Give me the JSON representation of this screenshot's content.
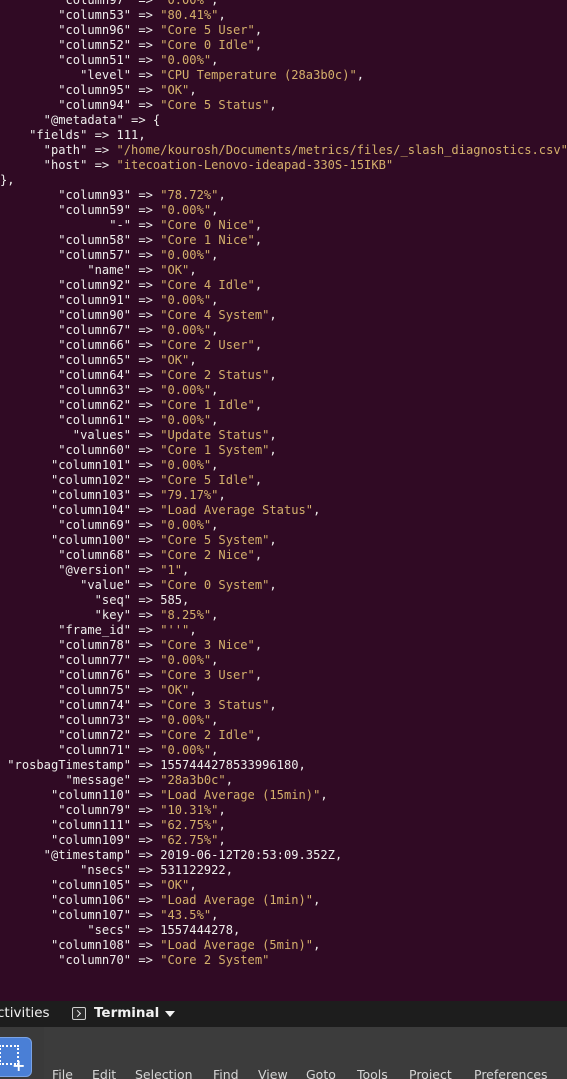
{
  "terminal_lines": [
    {
      "key": "        \"column97\"",
      "value": "\"0.00%\"",
      "sep": ","
    },
    {
      "key": "        \"column53\"",
      "value": "\"80.41%\"",
      "sep": ","
    },
    {
      "key": "        \"column96\"",
      "value": "\"Core 5 User\"",
      "sep": ","
    },
    {
      "key": "        \"column52\"",
      "value": "\"Core 0 Idle\"",
      "sep": ","
    },
    {
      "key": "        \"column51\"",
      "value": "\"0.00%\"",
      "sep": ","
    },
    {
      "key": "           \"level\"",
      "value": "\"CPU Temperature (28a3b0c)\"",
      "sep": ","
    },
    {
      "key": "        \"column95\"",
      "value": "\"OK\"",
      "sep": ","
    },
    {
      "key": "        \"column94\"",
      "value": "\"Core 5 Status\"",
      "sep": ","
    },
    {
      "key": "      \"@metadata\"",
      "value": "{",
      "sep": ""
    },
    {
      "key": "    \"fields\"",
      "value": "111",
      "sep": ","
    },
    {
      "key": "      \"path\"",
      "value": "\"/home/kourosh/Documents/metrics/files/_slash_diagnostics.csv\"",
      "sep": ","
    },
    {
      "key": "      \"host\"",
      "value": "\"itecoation-Lenovo-ideapad-330S-15IKB\"",
      "sep": ""
    },
    {
      "raw": "},"
    },
    {
      "key": "        \"column93\"",
      "value": "\"78.72%\"",
      "sep": ","
    },
    {
      "key": "        \"column59\"",
      "value": "\"0.00%\"",
      "sep": ","
    },
    {
      "key": "               \"-\"",
      "value": "\"Core 0 Nice\"",
      "sep": ","
    },
    {
      "key": "        \"column58\"",
      "value": "\"Core 1 Nice\"",
      "sep": ","
    },
    {
      "key": "        \"column57\"",
      "value": "\"0.00%\"",
      "sep": ","
    },
    {
      "key": "            \"name\"",
      "value": "\"OK\"",
      "sep": ","
    },
    {
      "key": "        \"column92\"",
      "value": "\"Core 4 Idle\"",
      "sep": ","
    },
    {
      "key": "        \"column91\"",
      "value": "\"0.00%\"",
      "sep": ","
    },
    {
      "key": "        \"column90\"",
      "value": "\"Core 4 System\"",
      "sep": ","
    },
    {
      "key": "        \"column67\"",
      "value": "\"0.00%\"",
      "sep": ","
    },
    {
      "key": "        \"column66\"",
      "value": "\"Core 2 User\"",
      "sep": ","
    },
    {
      "key": "        \"column65\"",
      "value": "\"OK\"",
      "sep": ","
    },
    {
      "key": "        \"column64\"",
      "value": "\"Core 2 Status\"",
      "sep": ","
    },
    {
      "key": "        \"column63\"",
      "value": "\"0.00%\"",
      "sep": ","
    },
    {
      "key": "        \"column62\"",
      "value": "\"Core 1 Idle\"",
      "sep": ","
    },
    {
      "key": "        \"column61\"",
      "value": "\"0.00%\"",
      "sep": ","
    },
    {
      "key": "          \"values\"",
      "value": "\"Update Status\"",
      "sep": ","
    },
    {
      "key": "        \"column60\"",
      "value": "\"Core 1 System\"",
      "sep": ","
    },
    {
      "key": "       \"column101\"",
      "value": "\"0.00%\"",
      "sep": ","
    },
    {
      "key": "       \"column102\"",
      "value": "\"Core 5 Idle\"",
      "sep": ","
    },
    {
      "key": "       \"column103\"",
      "value": "\"79.17%\"",
      "sep": ","
    },
    {
      "key": "       \"column104\"",
      "value": "\"Load Average Status\"",
      "sep": ","
    },
    {
      "key": "        \"column69\"",
      "value": "\"0.00%\"",
      "sep": ","
    },
    {
      "key": "       \"column100\"",
      "value": "\"Core 5 System\"",
      "sep": ","
    },
    {
      "key": "        \"column68\"",
      "value": "\"Core 2 Nice\"",
      "sep": ","
    },
    {
      "key": "        \"@version\"",
      "value": "\"1\"",
      "sep": ","
    },
    {
      "key": "           \"value\"",
      "value": "\"Core 0 System\"",
      "sep": ","
    },
    {
      "key": "             \"seq\"",
      "value": "585",
      "sep": ","
    },
    {
      "key": "             \"key\"",
      "value": "\"8.25%\"",
      "sep": ","
    },
    {
      "key": "        \"frame_id\"",
      "value": "\"''\"",
      "sep": ","
    },
    {
      "key": "        \"column78\"",
      "value": "\"Core 3 Nice\"",
      "sep": ","
    },
    {
      "key": "        \"column77\"",
      "value": "\"0.00%\"",
      "sep": ","
    },
    {
      "key": "        \"column76\"",
      "value": "\"Core 3 User\"",
      "sep": ","
    },
    {
      "key": "        \"column75\"",
      "value": "\"OK\"",
      "sep": ","
    },
    {
      "key": "        \"column74\"",
      "value": "\"Core 3 Status\"",
      "sep": ","
    },
    {
      "key": "        \"column73\"",
      "value": "\"0.00%\"",
      "sep": ","
    },
    {
      "key": "        \"column72\"",
      "value": "\"Core 2 Idle\"",
      "sep": ","
    },
    {
      "key": "        \"column71\"",
      "value": "\"0.00%\"",
      "sep": ","
    },
    {
      "key": " \"rosbagTimestamp\"",
      "value": "1557444278533996180",
      "sep": ","
    },
    {
      "key": "         \"message\"",
      "value": "\"28a3b0c\"",
      "sep": ","
    },
    {
      "key": "       \"column110\"",
      "value": "\"Load Average (15min)\"",
      "sep": ","
    },
    {
      "key": "        \"column79\"",
      "value": "\"10.31%\"",
      "sep": ","
    },
    {
      "key": "       \"column111\"",
      "value": "\"62.75%\"",
      "sep": ","
    },
    {
      "key": "       \"column109\"",
      "value": "\"62.75%\"",
      "sep": ","
    },
    {
      "key": "      \"@timestamp\"",
      "value": "2019-06-12T20:53:09.352Z",
      "sep": ","
    },
    {
      "key": "           \"nsecs\"",
      "value": "531122922",
      "sep": ","
    },
    {
      "key": "       \"column105\"",
      "value": "\"OK\"",
      "sep": ","
    },
    {
      "key": "       \"column106\"",
      "value": "\"Load Average (1min)\"",
      "sep": ","
    },
    {
      "key": "       \"column107\"",
      "value": "\"43.5%\"",
      "sep": ","
    },
    {
      "key": "            \"secs\"",
      "value": "1557444278",
      "sep": ","
    },
    {
      "key": "       \"column108\"",
      "value": "\"Load Average (5min)\"",
      "sep": ","
    },
    {
      "key": "        \"column70\"",
      "value": "\"Core 2 System\"",
      "sep": ""
    }
  ],
  "arrow": " => ",
  "topbar": {
    "activities_label": "ctivities",
    "terminal_label": "Terminal"
  },
  "editor_menu": [
    "File",
    "Edit",
    "Selection",
    "Find",
    "View",
    "Goto",
    "Tools",
    "Project",
    "Preferences"
  ],
  "colors": {
    "terminal_bg": "#300a24",
    "terminal_fg": "#eeeeec",
    "string_color": "#d5b06b",
    "topbar_bg": "#1d1d1d",
    "editor_bg": "#3c3c3c"
  },
  "icons": {
    "terminal_app": "terminal-icon",
    "dropdown": "chevron-down-icon",
    "dock_app": "screenshot-tool-icon"
  }
}
